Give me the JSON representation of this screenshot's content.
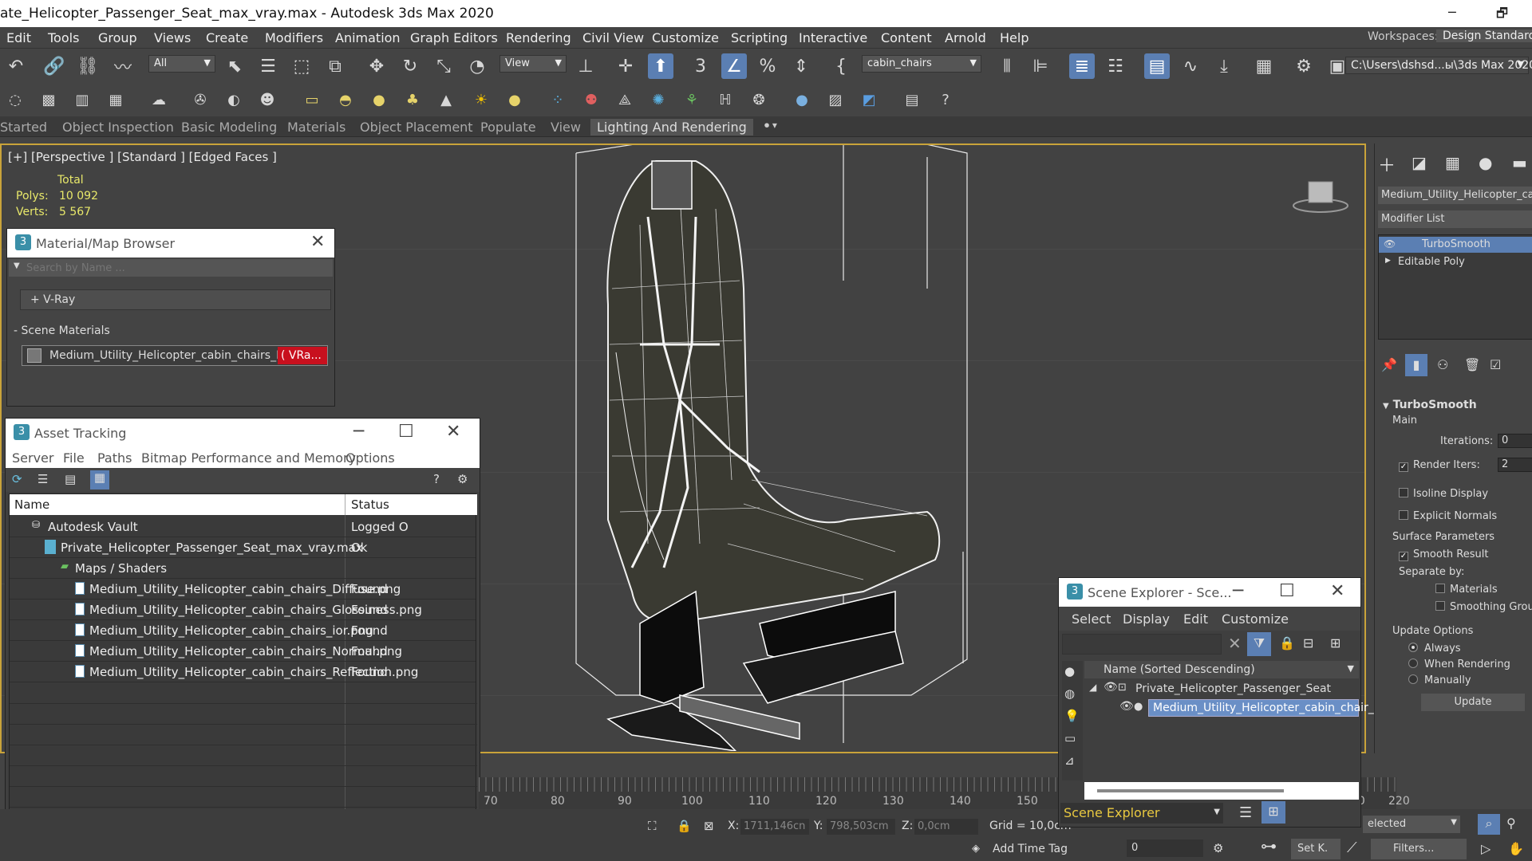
{
  "window": {
    "title": "ate_Helicopter_Passenger_Seat_max_vray.max - Autodesk 3ds Max 2020",
    "minimize": "─",
    "restore": "🗗"
  },
  "menu": [
    "Edit",
    "Tools",
    "Group",
    "Views",
    "Create",
    "Modifiers",
    "Animation",
    "Graph Editors",
    "Rendering",
    "Civil View",
    "Customize",
    "Scripting",
    "Interactive",
    "Content",
    "Arnold",
    "Help"
  ],
  "workspace": {
    "label": "Workspaces:",
    "value": "Design Standard"
  },
  "toolbar": {
    "selection_filter": "All",
    "ref_coord": "View",
    "named_set": "cabin_chairs",
    "path": "C:\\Users\\dshsd...ы\\3ds Max 2020"
  },
  "ribbon": [
    "Started",
    "Object Inspection",
    "Basic Modeling",
    "Materials",
    "Object Placement",
    "Populate",
    "View",
    "Lighting And Rendering"
  ],
  "viewport": {
    "label": "[+] [Perspective ] [Standard ] [Edged Faces ]",
    "stats": {
      "total": "Total",
      "polys_label": "Polys:",
      "polys": "10 092",
      "verts_label": "Verts:",
      "verts": "5 567"
    }
  },
  "material_browser": {
    "title": "Material/Map Browser",
    "search_placeholder": "Search by Name ...",
    "vray": "+ V-Ray",
    "scene_materials": "- Scene Materials",
    "material": "Medium_Utility_Helicopter_cabin_chairs_MAT",
    "material_type": "( VRa..."
  },
  "asset_tracking": {
    "title": "Asset Tracking",
    "menu": [
      "Server",
      "File",
      "Paths",
      "Bitmap Performance and Memory",
      "Options"
    ],
    "columns": [
      "Name",
      "Status"
    ],
    "rows": [
      {
        "name": "Autodesk Vault",
        "status": "Logged O"
      },
      {
        "name": "Private_Helicopter_Passenger_Seat_max_vray.max",
        "status": "Ok"
      },
      {
        "name": "Maps / Shaders",
        "status": ""
      },
      {
        "name": "Medium_Utility_Helicopter_cabin_chairs_Diffuse.png",
        "status": "Found"
      },
      {
        "name": "Medium_Utility_Helicopter_cabin_chairs_Glossiness.png",
        "status": "Found"
      },
      {
        "name": "Medium_Utility_Helicopter_cabin_chairs_ior.png",
        "status": "Found"
      },
      {
        "name": "Medium_Utility_Helicopter_cabin_chairs_Normal.png",
        "status": "Found"
      },
      {
        "name": "Medium_Utility_Helicopter_cabin_chairs_Reflection.png",
        "status": "Found"
      }
    ]
  },
  "scene_explorer": {
    "title": "Scene Explorer - Sce...",
    "menu": [
      "Select",
      "Display",
      "Edit",
      "Customize"
    ],
    "column": "Name (Sorted Descending)",
    "parent": "Private_Helicopter_Passenger_Seat",
    "child": "Medium_Utility_Helicopter_cabin_chair_01",
    "footer": "Scene Explorer"
  },
  "command_panel": {
    "object_name": "Medium_Utility_Helicopter_cabi",
    "modifier_list": "Modifier List",
    "stack": [
      "TurboSmooth",
      "Editable Poly"
    ],
    "turbosmooth": {
      "title": "TurboSmooth",
      "main": "Main",
      "iterations_label": "Iterations:",
      "iterations": "0",
      "render_iters_label": "Render Iters:",
      "render_iters": "2",
      "isoline": "Isoline Display",
      "explicit": "Explicit Normals",
      "surface": "Surface Parameters",
      "smooth_result": "Smooth Result",
      "separate": "Separate by:",
      "materials": "Materials",
      "smoothing": "Smoothing Groups",
      "update_options": "Update Options",
      "always": "Always",
      "when_rendering": "When Rendering",
      "manually": "Manually",
      "update": "Update"
    }
  },
  "timeline": {
    "ticks": [
      "70",
      "80",
      "90",
      "100",
      "110",
      "120",
      "130",
      "140",
      "150",
      "200",
      "210",
      "220"
    ]
  },
  "status": {
    "x_label": "X:",
    "x": "1711,146cn",
    "y_label": "Y:",
    "y": "798,503cm",
    "z_label": "Z:",
    "z": "0,0cm",
    "grid": "Grid = 10,0cm",
    "add_time_tag": "Add Time Tag",
    "frame": "0",
    "set_key": "Set K.",
    "filters": "Filters...",
    "selected": "elected"
  },
  "colors": {
    "accent": "#5b7fb3",
    "viewport_border": "#c9a33a",
    "material_badge": "#c8101e",
    "selection": "#6a8fc6"
  }
}
